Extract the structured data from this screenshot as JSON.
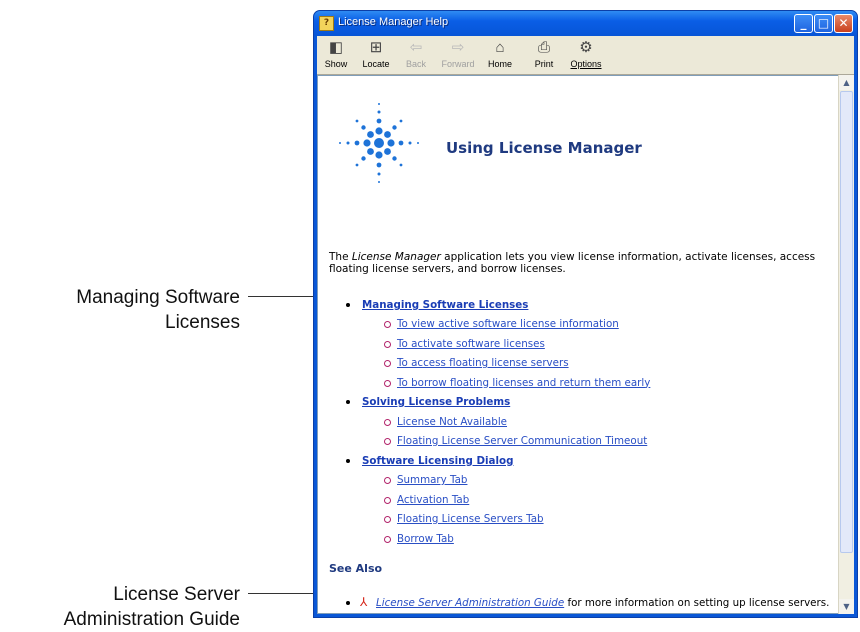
{
  "callouts": {
    "managing": [
      "Managing Software",
      "Licenses"
    ],
    "server_guide": [
      "License Server",
      "Administration Guide"
    ]
  },
  "window": {
    "title": "License Manager Help",
    "title_icon": "help-book-icon",
    "controls": {
      "minimize": "_",
      "maximize": "□",
      "close": "✕"
    }
  },
  "toolbar": {
    "show": "Show",
    "locate": "Locate",
    "back": "Back",
    "forward": "Forward",
    "home": "Home",
    "print": "Print",
    "options": "Options"
  },
  "page": {
    "heading": "Using License Manager",
    "intro_em": "License Manager",
    "intro_before": "The ",
    "intro_after": " application lets you view license information, activate licenses, access floating license servers, and borrow licenses.",
    "sections": [
      {
        "title": "Managing Software Licenses",
        "items": [
          "To view active software license information",
          "To activate software licenses",
          "To access floating license servers",
          "To borrow floating licenses and return them early"
        ]
      },
      {
        "title": "Solving License Problems",
        "items": [
          "License Not Available",
          "Floating License Server Communication Timeout"
        ]
      },
      {
        "title": "Software Licensing Dialog",
        "items": [
          "Summary Tab",
          "Activation Tab",
          "Floating License Servers Tab",
          "Borrow Tab"
        ]
      }
    ],
    "see_also": "See Also",
    "reference_link": "License Server Administration Guide",
    "reference_rest": " for more information on setting up license servers."
  },
  "colors": {
    "link": "#2a4fc5",
    "heading": "#1f3a80",
    "titlebar": "#0a5ee6",
    "accent_dots": "#1e73d8"
  }
}
